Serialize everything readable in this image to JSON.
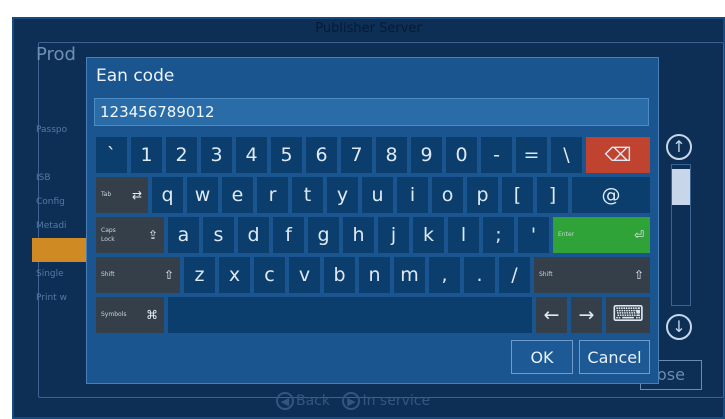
{
  "app": {
    "window_title": "Publisher Server",
    "heading": "Prod",
    "list_items": [
      "Passpo",
      "",
      "ISB",
      "Config",
      "Metadi",
      "",
      "Single",
      "Print w"
    ],
    "close_label": "ose",
    "footer": {
      "back_label": "Back",
      "service_label": "In service"
    }
  },
  "dialog": {
    "title": "Ean code",
    "value": "123456789012",
    "ok_label": "OK",
    "cancel_label": "Cancel"
  },
  "keyboard": {
    "row1": [
      "`",
      "1",
      "2",
      "3",
      "4",
      "5",
      "6",
      "7",
      "8",
      "9",
      "0",
      "-",
      "=",
      "\\"
    ],
    "backspace_symbol": "⌫",
    "tab_label": "Tab",
    "tab_symbol": "⇄",
    "row2": [
      "q",
      "w",
      "e",
      "r",
      "t",
      "y",
      "u",
      "i",
      "o",
      "p",
      "[",
      "]"
    ],
    "at_key": "@",
    "caps_label": "Caps Lock",
    "caps_symbol": "⇪",
    "row3": [
      "a",
      "s",
      "d",
      "f",
      "g",
      "h",
      "j",
      "k",
      "l",
      ";",
      "'"
    ],
    "enter_label": "Enter",
    "enter_symbol": "⏎",
    "shift_label": "Shift",
    "shift_symbol": "⇧",
    "row4": [
      "z",
      "x",
      "c",
      "v",
      "b",
      "n",
      "m",
      ",",
      ".",
      "/"
    ],
    "symbols_label": "Symbols",
    "symbols_symbol": "⌘",
    "left_arrow": "←",
    "right_arrow": "→",
    "keyboard_symbol": "⌨"
  },
  "scroll": {
    "up": "↑",
    "down": "↓"
  },
  "colors": {
    "dialog_bg": "#1a5590",
    "key_bg": "#0c3e6d",
    "modifier_bg": "#343f4a",
    "backspace_bg": "#c0432f",
    "enter_bg": "#2fa238"
  }
}
